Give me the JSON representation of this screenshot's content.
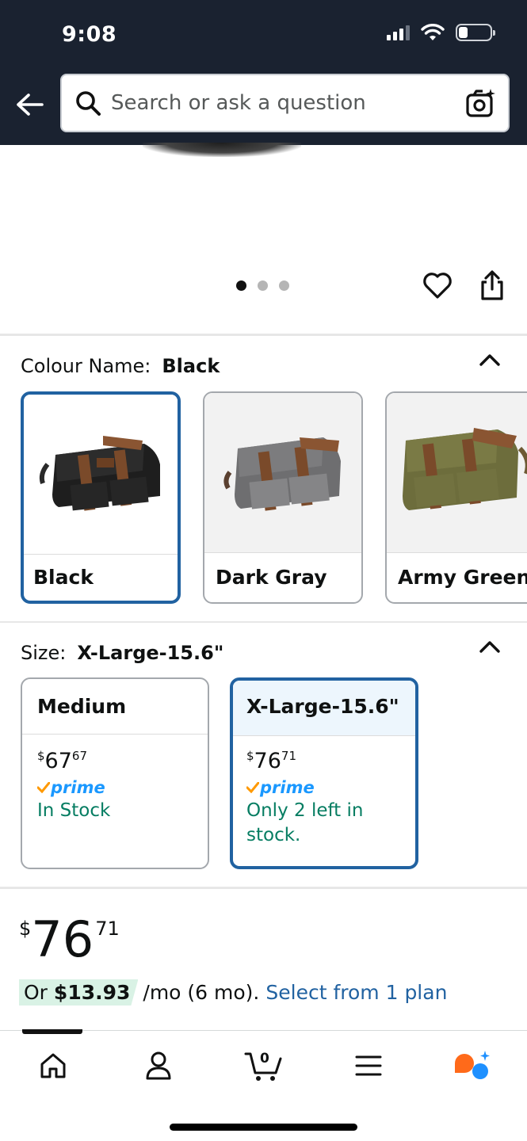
{
  "status_bar": {
    "time": "9:08"
  },
  "search": {
    "placeholder": "Search or ask a question"
  },
  "gallery": {
    "dot_count": 3,
    "active_dot": 0
  },
  "colour": {
    "label": "Colour Name:",
    "selected": "Black",
    "options": [
      {
        "name": "Black",
        "selected": true
      },
      {
        "name": "Dark Gray",
        "selected": false
      },
      {
        "name": "Army Green",
        "selected": false
      }
    ]
  },
  "size": {
    "label": "Size:",
    "selected": "X-Large-15.6\"",
    "options": [
      {
        "name": "Medium",
        "price_symbol": "$",
        "price_whole": "67",
        "price_fraction": "67",
        "prime": "prime",
        "stock": "In Stock",
        "selected": false
      },
      {
        "name": "X-Large-15.6\"",
        "price_symbol": "$",
        "price_whole": "76",
        "price_fraction": "71",
        "prime": "prime",
        "stock": "Only 2 left in stock.",
        "selected": true
      }
    ]
  },
  "price": {
    "symbol": "$",
    "whole": "76",
    "fraction": "71"
  },
  "plan": {
    "prefix": "Or",
    "amount": "$13.93",
    "term": "/mo (6 mo).",
    "link": "Select from 1 plan"
  },
  "bottom_nav": {
    "cart_count": "0"
  },
  "colors": {
    "header_bg": "#1a2230",
    "selected_border": "#2162a1",
    "link": "#2162a1",
    "stock_green": "#067d62",
    "prime_blue": "#1a98ff",
    "prime_check": "#ff9900",
    "plan_badge_bg": "#d9f2e5"
  }
}
